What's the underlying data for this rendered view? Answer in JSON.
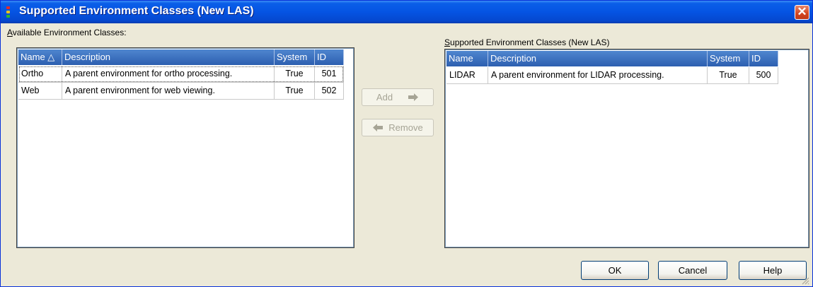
{
  "window": {
    "title": "Supported Environment Classes  (New LAS)",
    "close_label": "✕"
  },
  "available": {
    "label_prefix": "A",
    "label_rest": "vailable Environment Classes:",
    "columns": [
      "Name △",
      "Description",
      "System",
      "ID"
    ],
    "rows": [
      {
        "name": "Ortho",
        "description": "A parent environment for ortho processing.",
        "system": "True",
        "id": "501"
      },
      {
        "name": "Web",
        "description": "A parent environment for web viewing.",
        "system": "True",
        "id": "502"
      }
    ]
  },
  "supported": {
    "label_prefix": "S",
    "label_rest": "upported Environment Classes  (New LAS)",
    "columns": [
      "Name",
      "Description",
      "System",
      "ID"
    ],
    "rows": [
      {
        "name": "LIDAR",
        "description": "A parent environment for LIDAR processing.",
        "system": "True",
        "id": "500"
      }
    ]
  },
  "buttons": {
    "add": "Add",
    "remove": "Remove",
    "ok": "OK",
    "cancel": "Cancel",
    "help": "Help"
  }
}
